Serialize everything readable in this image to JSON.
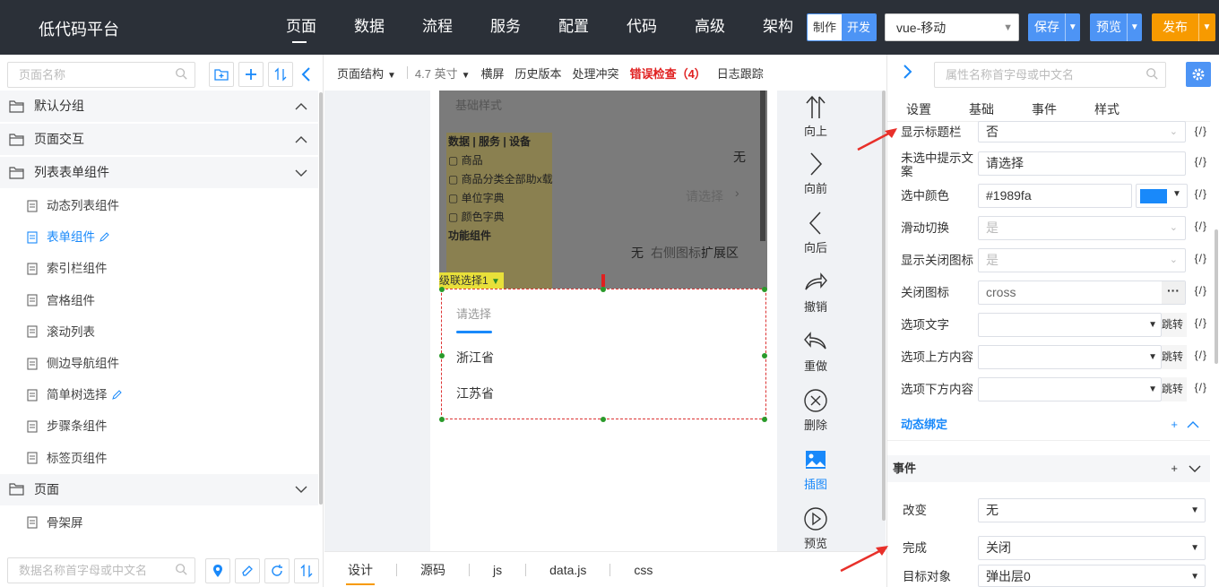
{
  "app": {
    "title": "低代码平台",
    "nav": [
      "页面",
      "数据",
      "流程",
      "服务",
      "配置",
      "代码",
      "高级",
      "架构"
    ],
    "mode": {
      "make": "制作",
      "dev": "开发"
    },
    "platform": "vue-移动",
    "save": "保存",
    "preview": "预览",
    "publish": "发布"
  },
  "left": {
    "search_placeholder": "页面名称",
    "bottom_search_placeholder": "数据名称首字母或中文名",
    "groups": [
      {
        "label": "默认分组"
      },
      {
        "label": "页面交互"
      },
      {
        "label": "列表表单组件"
      }
    ],
    "items": [
      "动态列表组件",
      "表单组件",
      "索引栏组件",
      "宫格组件",
      "滚动列表",
      "侧边导航组件",
      "简单树选择",
      "步骤条组件",
      "标签页组件"
    ],
    "group_page": "页面",
    "item_skeleton": "骨架屏"
  },
  "toolbar": {
    "structure": "页面结构",
    "size": "4.7 英寸",
    "landscape": "横屏",
    "history": "历史版本",
    "conflict": "处理冲突",
    "errors": "错误检查（4）",
    "log": "日志跟踪"
  },
  "canvas": {
    "basic_style": "基础样式",
    "none1": "无",
    "please_select": "请选择",
    "none2": "无",
    "right_icon": "右侧图标",
    "ext_area": "扩展区",
    "ghost_header": "数据 | 服务 | 设备",
    "ghost_items": [
      "商品",
      "商品分类全部助x载",
      "单位字典",
      "颜色字典"
    ],
    "ghost_func": "功能组件",
    "selected_tag": "级联选择1",
    "picker_placeholder": "请选择",
    "options": [
      "浙江省",
      "江苏省"
    ]
  },
  "actions": [
    "向上",
    "向前",
    "向后",
    "撤销",
    "重做",
    "删除",
    "插图",
    "预览"
  ],
  "bottom_tabs": [
    "设计",
    "源码",
    "js",
    "data.js",
    "css"
  ],
  "right": {
    "search_placeholder": "属性名称首字母或中文名",
    "tabs": [
      "设置",
      "基础",
      "事件",
      "样式"
    ],
    "props": [
      {
        "label": "显示标题栏",
        "value": "否"
      },
      {
        "label": "未选中提示文案",
        "value": "请选择"
      },
      {
        "label": "选中颜色",
        "value": "#1989fa",
        "color": "#1989fa"
      },
      {
        "label": "滑动切换",
        "value": "是"
      },
      {
        "label": "显示关闭图标",
        "value": "是"
      },
      {
        "label": "关闭图标",
        "value": "cross"
      },
      {
        "label": "选项文字",
        "value": ""
      },
      {
        "label": "选项上方内容",
        "value": ""
      },
      {
        "label": "选项下方内容",
        "value": ""
      }
    ],
    "braces": "{/}",
    "jump": "跳转",
    "dynamic_binding": "动态绑定",
    "events_title": "事件",
    "events": [
      {
        "label": "改变",
        "value": "无"
      },
      {
        "label": "完成",
        "value": "关闭"
      },
      {
        "label": "目标对象",
        "value": "弹出层0"
      }
    ],
    "accent": "#1989fa"
  }
}
